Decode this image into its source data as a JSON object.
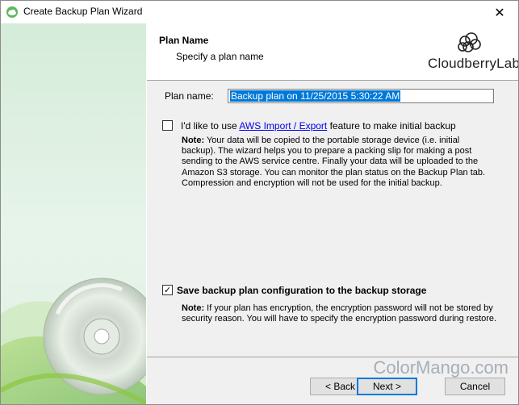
{
  "window": {
    "title": "Create Backup Plan Wizard",
    "close_glyph": "✕"
  },
  "header": {
    "title": "Plan Name",
    "subtitle": "Specify a plan name",
    "logo_text": "CloudberryLab"
  },
  "form": {
    "plan_name_label": "Plan name:",
    "plan_name_value": "Backup plan on 11/25/2015 5:30:22 AM"
  },
  "aws_option": {
    "checked": false,
    "label_before": "I'd like to use ",
    "link_text": "AWS Import / Export",
    "label_after": " feature to make initial backup",
    "note_label": "Note:",
    "note_text": "  Your data will be copied to the portable storage device (i.e. initial backup). The wizard helps you to prepare a packing slip for making a post sending to the AWS service centre. Finally your data will be uploaded to the Amazon S3 storage. You can monitor the plan status on the Backup Plan tab. Compression and encryption will not be used for the initial backup."
  },
  "save_option": {
    "checked": true,
    "check_glyph": "✓",
    "label": "Save backup plan configuration to the backup storage",
    "note_label": "Note:",
    "note_text": "  If your plan has encryption, the encryption password will not be stored by security reason. You will have to specify the encryption password during restore."
  },
  "footer": {
    "back_label": "< Back",
    "next_label": "Next >",
    "cancel_label": "Cancel"
  },
  "watermark": "ColorMango.com",
  "colors": {
    "accent": "#0078d7",
    "link": "#0000ee",
    "sidebar": "#d5ecd9"
  }
}
